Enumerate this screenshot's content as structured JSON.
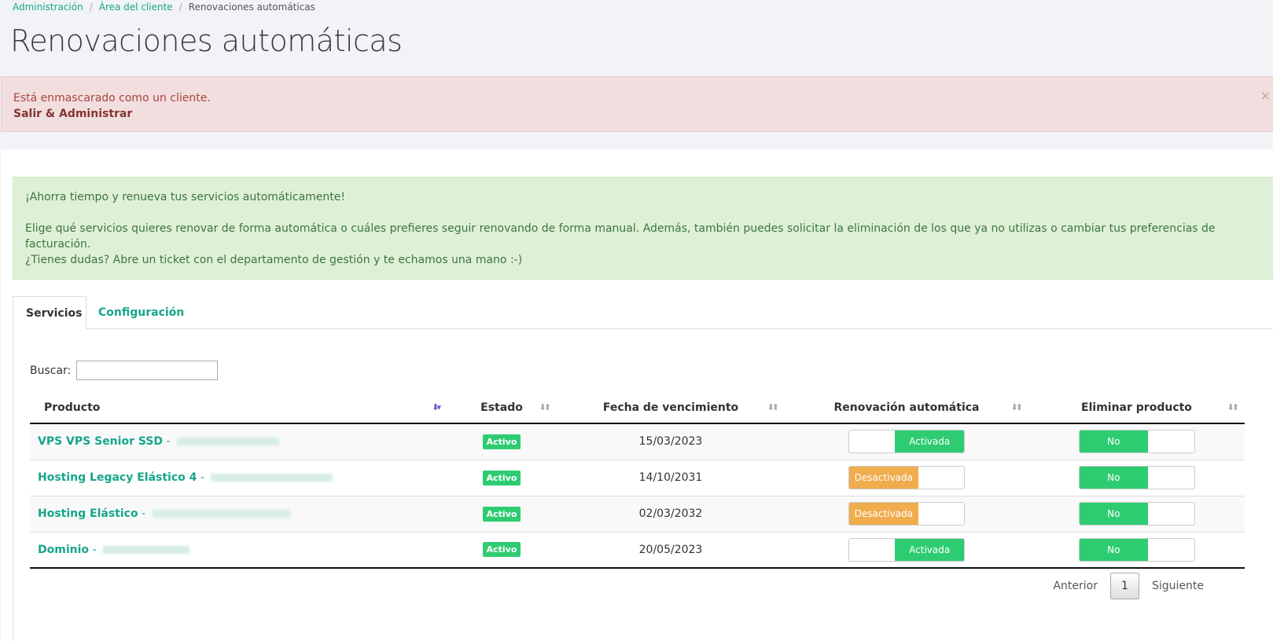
{
  "breadcrumb": {
    "admin": "Administración",
    "client_area": "Área del cliente",
    "current": "Renovaciones automáticas",
    "separator": "/"
  },
  "page": {
    "title": "Renovaciones automáticas"
  },
  "masq_alert": {
    "text": "Está enmascarado como un cliente.",
    "link": "Salir & Administrar",
    "close": "×"
  },
  "info_alert": {
    "line1": "¡Ahorra tiempo y renueva tus servicios automáticamente!",
    "line2": "Elige qué servicios quieres renovar de forma automática o cuáles prefieres seguir renovando de forma manual. Además, también puedes solicitar la eliminación de los que ya no utilizas o cambiar tus preferencias de facturación.",
    "line3": "¿Tienes dudas? Abre un ticket con el departamento de gestión y te echamos una mano :-)"
  },
  "tabs": {
    "services": "Servicios",
    "config": "Configuración"
  },
  "search": {
    "label": "Buscar:",
    "value": ""
  },
  "table": {
    "headers": {
      "product": "Producto",
      "status": "Estado",
      "due": "Fecha de vencimiento",
      "auto": "Renovación automática",
      "delete": "Eliminar producto"
    },
    "rows": [
      {
        "product": "VPS VPS Senior SSD",
        "sep": " - ",
        "status": "Activo",
        "due": "15/03/2023",
        "auto": "Activada",
        "delete": "No"
      },
      {
        "product": "Hosting Legacy Elástico 4",
        "sep": " - ",
        "status": "Activo",
        "due": "14/10/2031",
        "auto": "Desactivada",
        "delete": "No"
      },
      {
        "product": "Hosting Elástico",
        "sep": " - ",
        "status": "Activo",
        "due": "02/03/2032",
        "auto": "Desactivada",
        "delete": "No"
      },
      {
        "product": "Dominio",
        "sep": " - ",
        "status": "Activo",
        "due": "20/05/2023",
        "auto": "Activada",
        "delete": "No"
      }
    ]
  },
  "pagination": {
    "prev": "Anterior",
    "page": "1",
    "next": "Siguiente"
  },
  "colors": {
    "accent": "#16a68a",
    "green": "#2ecc71",
    "orange": "#f0ad4e"
  }
}
